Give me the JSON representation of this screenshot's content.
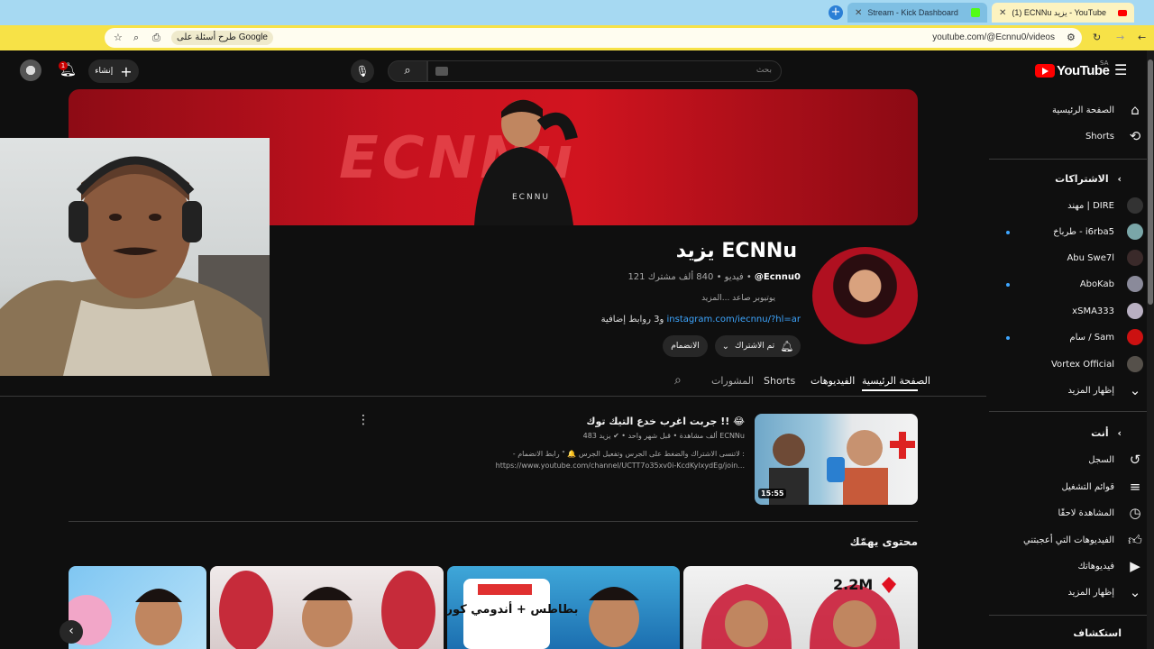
{
  "browser": {
    "tabs": [
      {
        "title": "(1) ECNNu يزيد - YouTube",
        "active": true
      },
      {
        "title": "Stream - Kick Dashboard",
        "active": false
      }
    ],
    "url": "youtube.com/@Ecnnu0/videos",
    "google_chip": "طرح أسئلة على Google"
  },
  "masthead": {
    "logo": "YouTube",
    "country": "SA",
    "search_placeholder": "بحث",
    "create_label": "إنشاء",
    "notification_count": "1"
  },
  "sidebar": {
    "top": [
      {
        "label": "الصفحة الرئيسية",
        "icon": "home-icon"
      },
      {
        "label": "Shorts",
        "icon": "shorts-icon"
      }
    ],
    "subscriptions_title": "الاشتراكات",
    "subscriptions": [
      {
        "label": "مهند | DIRE",
        "dot": false,
        "color": "#333333"
      },
      {
        "label": "طرباخ - i6rba5",
        "dot": true,
        "color": "#7aa6a8"
      },
      {
        "label": "Abu Swe7l",
        "dot": false,
        "color": "#3a2a2a"
      },
      {
        "label": "AboKab",
        "dot": true,
        "color": "#8a8a9a"
      },
      {
        "label": "xSMA333",
        "dot": false,
        "color": "#b9b0c2"
      },
      {
        "label": "سام / Sam",
        "dot": true,
        "color": "#cc1111"
      },
      {
        "label": "Vortex Official",
        "dot": false,
        "color": "#55504a"
      }
    ],
    "show_more_1": "إظهار المزيد",
    "you_title": "أنت",
    "you": [
      {
        "label": "السجل",
        "icon": "history-icon"
      },
      {
        "label": "قوائم التشغيل",
        "icon": "playlists-icon"
      },
      {
        "label": "المشاهدة لاحقًا",
        "icon": "watch-later-icon"
      },
      {
        "label": "الفيديوهات التي أعجبتني",
        "icon": "liked-icon"
      },
      {
        "label": "فيديوهاتك",
        "icon": "your-videos-icon"
      }
    ],
    "show_more_2": "إظهار المزيد",
    "explore_title": "استكشاف"
  },
  "channel": {
    "banner_text": "ECNNu",
    "name": "يزيد ECNNu",
    "handle": "@Ecnnu0",
    "subscribers": "840 ألف مشترك",
    "videos_count": "121 فيديو",
    "description": "يوتيوبر صاعد ...المزيد",
    "link": "instagram.com/iecnnu/?hl=ar",
    "extra_links": "و3 روابط إضافية",
    "subscribed_label": "تم الاشتراك",
    "join_label": "الانضمام"
  },
  "tabs": {
    "home": "الصفحة الرئيسية",
    "videos": "الفيديوهات",
    "shorts": "Shorts",
    "posts": "المشورات"
  },
  "featured_video": {
    "title": "جربت اغرب خدع التيك توك !! 😂",
    "channel": "يزيد ECNNu",
    "meta": "483 ألف مشاهدة • قبل شهر واحد",
    "description": "- لاتنسى الاشتراك والضغط على الجرس وتفعيل الجرس 🔔 \" رابط الانضمام : https://www.youtube.com/channel/UCTT7o35xv0i-KcdKylxydEg/join...",
    "duration": "15:55"
  },
  "shelf": {
    "title": "محتوى يهمّك",
    "cards": [
      {
        "overlay": "2.2M"
      },
      {
        "overlay": "بطاطس + أندومي كوري"
      },
      {
        "overlay": ""
      },
      {
        "overlay": ""
      }
    ]
  },
  "colors": {
    "accent_red": "#ff0000",
    "link_blue": "#3ea6ff",
    "background": "#0f0f0f"
  }
}
